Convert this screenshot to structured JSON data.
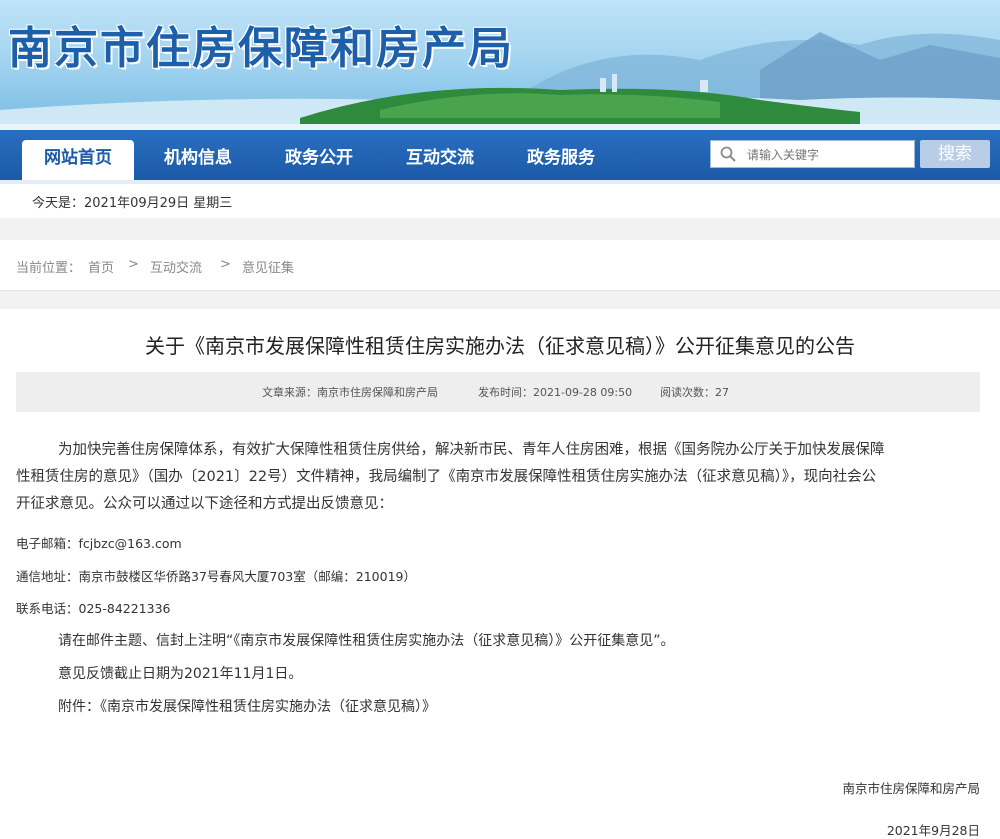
{
  "site": {
    "title": "南京市住房保障和房产局"
  },
  "nav": {
    "items": [
      "网站首页",
      "机构信息",
      "政务公开",
      "互动交流",
      "政务服务"
    ],
    "search_placeholder": "请输入关键字",
    "search_button": "搜索"
  },
  "date_bar": {
    "text": "今天是：2021年09月29日  星期三"
  },
  "breadcrumb": {
    "prefix": "当前位置：",
    "items": [
      "首页",
      "互动交流",
      "意见征集"
    ],
    "separator": ">"
  },
  "article": {
    "title": "关于《南京市发展保障性租赁住房实施办法（征求意见稿）》公开征集意见的公告",
    "meta": {
      "source": "文章来源：南京市住房保障和房产局",
      "published": "发布时间：2021-09-28 09:50",
      "views": "阅读次数：27"
    },
    "intro_lines": [
      "为加快完善住房保障体系，有效扩大保障性租赁住房供给，解决新市民、青年人住房困难，根据《国务院办公厅关于加快发展保障",
      "性租赁住房的意见》（国办〔2021〕22号）文件精神，我局编制了《南京市发展保障性租赁住房实施办法（征求意见稿）》，现向社会公",
      "开征求意见。公众可以通过以下途径和方式提出反馈意见："
    ],
    "email": "电子邮箱：fcjbzc@163.com",
    "address": "通信地址：南京市鼓楼区华侨路37号春风大厦703室（邮编：210019）",
    "phone": "联系电话：025-84221336",
    "note": "请在邮件主题、信封上注明“《南京市发展保障性租赁住房实施办法（征求意见稿）》公开征集意见”。",
    "deadline": "意见反馈截止日期为2021年11月1日。",
    "attachment": "附件：《南京市发展保障性租赁住房实施办法（征求意见稿）》",
    "signature": "南京市住房保障和房产局",
    "date": "2021年9月28日"
  }
}
